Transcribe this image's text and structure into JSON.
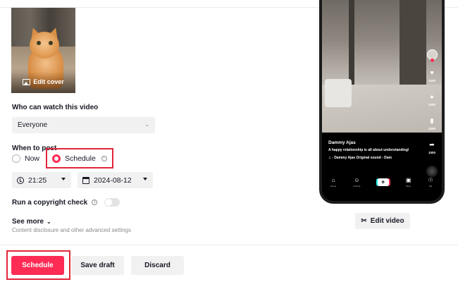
{
  "cover": {
    "edit_label": "Edit cover"
  },
  "privacy": {
    "label": "Who can watch this video",
    "selected": "Everyone"
  },
  "when": {
    "label": "When to post",
    "options": [
      {
        "label": "Now",
        "selected": false
      },
      {
        "label": "Schedule",
        "selected": true
      }
    ],
    "time": "21:25",
    "date": "2024-08-12"
  },
  "copyright": {
    "label": "Run a copyright check",
    "enabled": false
  },
  "see_more": {
    "label": "See more",
    "description": "Content disclosure and other advanced settings"
  },
  "actions": {
    "schedule": "Schedule",
    "save_draft": "Save draft",
    "discard": "Discard"
  },
  "preview": {
    "username": "Dammy Ajas",
    "caption": "A happy relationship is all about understanding!",
    "sound": "♫ - Dammy Ajas   Original sound - Dam",
    "counts": {
      "likes": "1000",
      "comments": "1000",
      "saves": "1000",
      "shares": "1000"
    },
    "tabs": [
      "Home",
      "Friends",
      "",
      "Inbox",
      "Me"
    ],
    "edit_video": "Edit video"
  },
  "colors": {
    "accent": "#fe2c55",
    "highlight_box": "#e2263a"
  }
}
